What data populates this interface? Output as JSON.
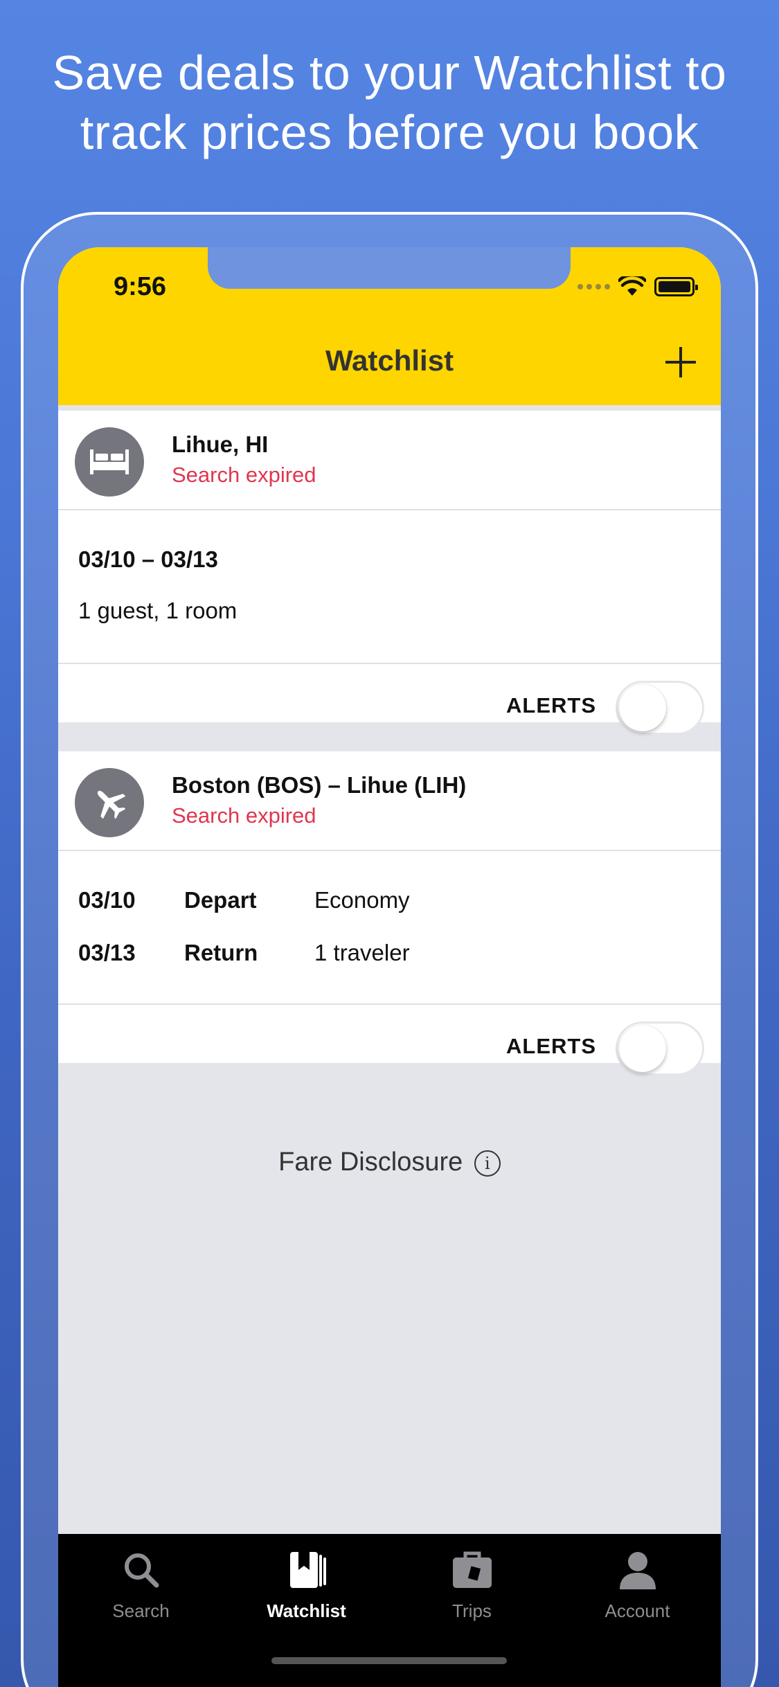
{
  "headline": {
    "line1": "Save deals to your Watchlist to",
    "line2": "track prices before you book"
  },
  "status_bar": {
    "time": "9:56"
  },
  "header": {
    "title": "Watchlist",
    "add_icon": "plus-icon"
  },
  "colors": {
    "header_bg": "#ffd500",
    "expired": "#e0364f",
    "tab_bar_bg": "#000000",
    "screen_bg": "#e4e5ea"
  },
  "hotel_card": {
    "icon": "bed-icon",
    "title": "Lihue, HI",
    "status": "Search expired",
    "dates": "03/10 – 03/13",
    "guests": "1 guest, 1 room",
    "alerts_label": "ALERTS",
    "alerts_on": false
  },
  "flight_card": {
    "icon": "airplane-icon",
    "title": "Boston (BOS) – Lihue (LIH)",
    "status": "Search expired",
    "rows": [
      {
        "date": "03/10",
        "type": "Depart",
        "info": "Economy"
      },
      {
        "date": "03/13",
        "type": "Return",
        "info": "1 traveler"
      }
    ],
    "alerts_label": "ALERTS",
    "alerts_on": false
  },
  "fare_disclosure": {
    "label": "Fare Disclosure",
    "icon": "info-icon"
  },
  "tabs": [
    {
      "label": "Search",
      "icon": "magnifier-icon",
      "active": false
    },
    {
      "label": "Watchlist",
      "icon": "bookmark-icon",
      "active": true
    },
    {
      "label": "Trips",
      "icon": "suitcase-icon",
      "active": false
    },
    {
      "label": "Account",
      "icon": "person-icon",
      "active": false
    }
  ]
}
